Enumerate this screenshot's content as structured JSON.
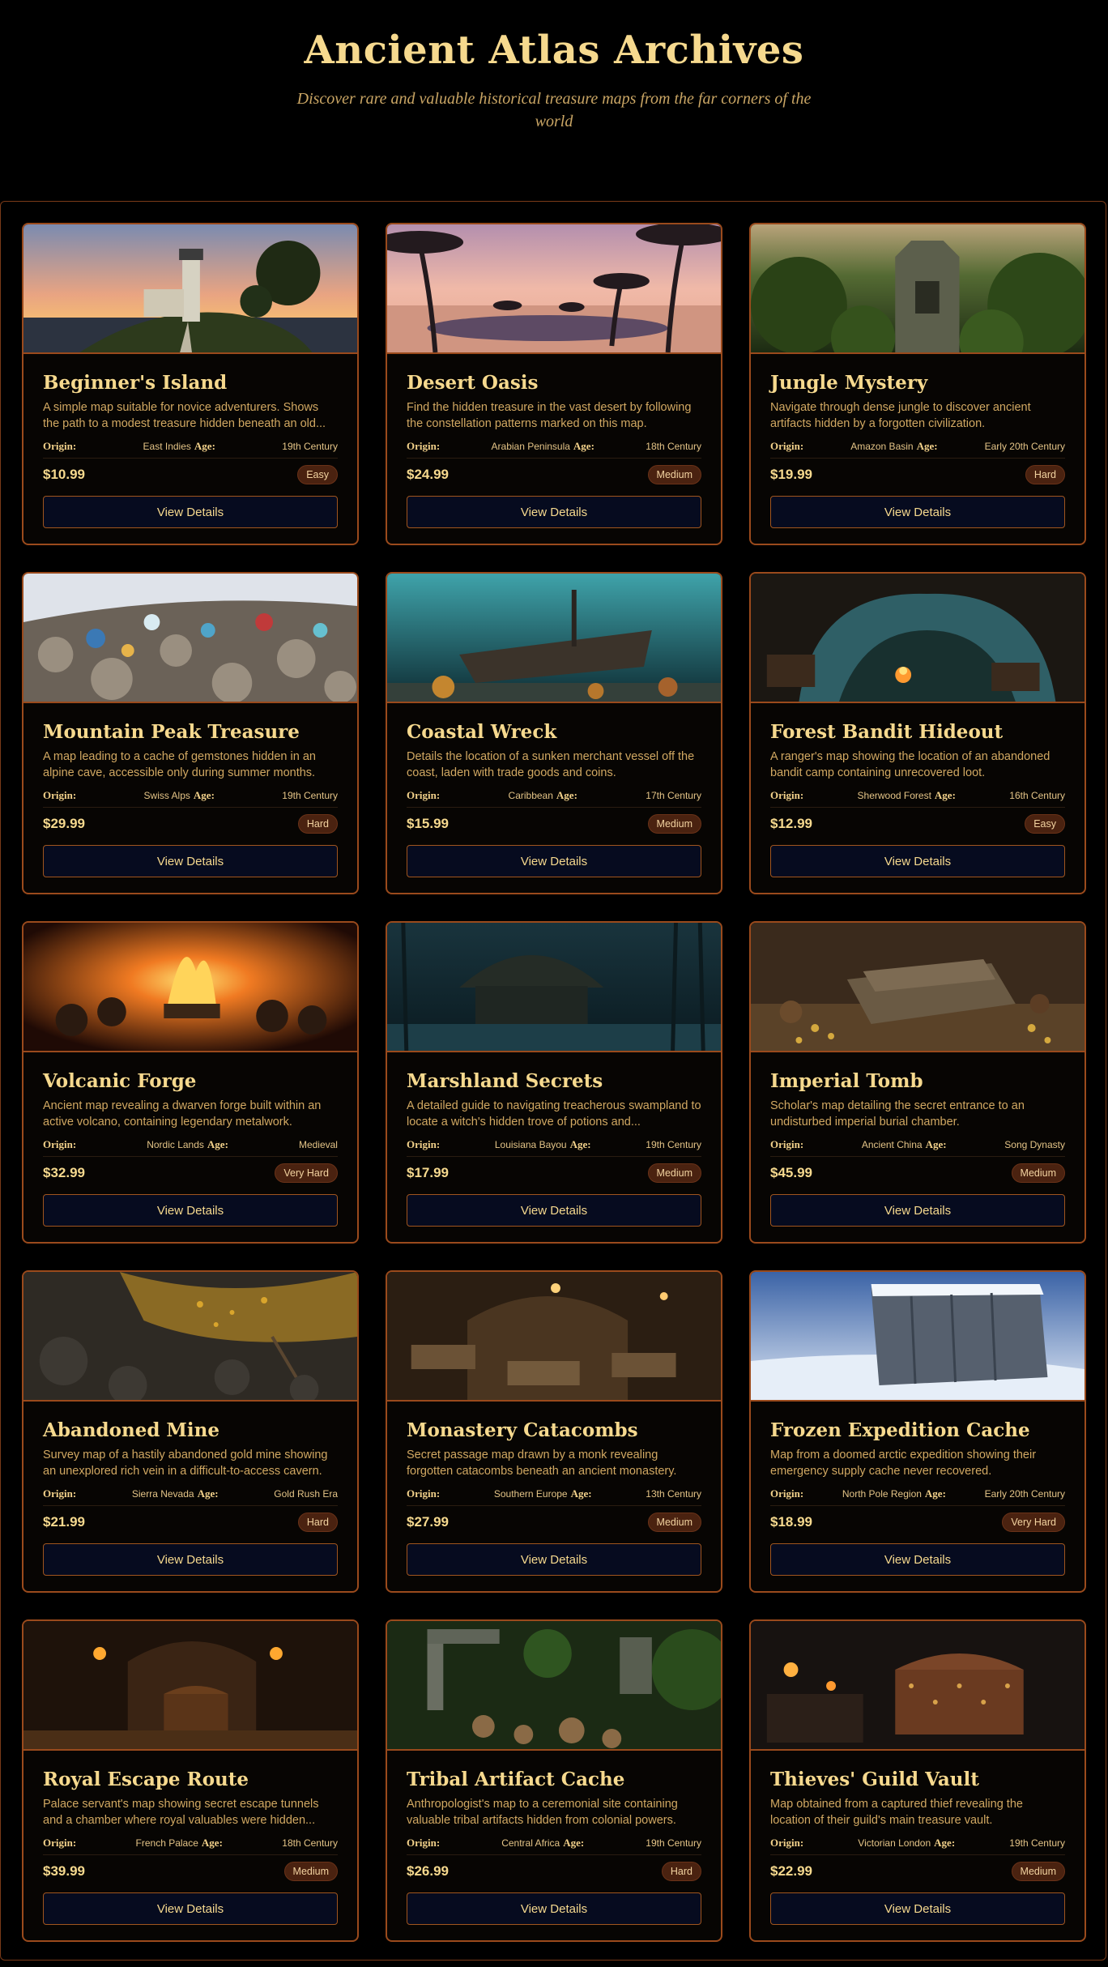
{
  "header": {
    "title": "Ancient Atlas Archives",
    "subtitle": "Discover rare and valuable historical treasure maps from the far corners of the world"
  },
  "labels": {
    "origin": "Origin:",
    "age": "Age:",
    "button": "View Details"
  },
  "colors": {
    "accent": "#f6d98e",
    "border": "#9a4a1c",
    "button_bg": "#060b1f",
    "badge_bg": "#4a2210"
  },
  "maps": [
    {
      "title": "Beginner's Island",
      "description": "A simple map suitable for novice adventurers. Shows the path to a modest treasure hidden beneath an old...",
      "origin": "East Indies",
      "age": "19th Century",
      "price": "$10.99",
      "difficulty": "Easy",
      "image": "lighthouse-island"
    },
    {
      "title": "Desert Oasis",
      "description": "Find the hidden treasure in the vast desert by following the constellation patterns marked on this map.",
      "origin": "Arabian Peninsula",
      "age": "18th Century",
      "price": "$24.99",
      "difficulty": "Medium",
      "image": "desert-oasis"
    },
    {
      "title": "Jungle Mystery",
      "description": "Navigate through dense jungle to discover ancient artifacts hidden by a forgotten civilization.",
      "origin": "Amazon Basin",
      "age": "Early 20th Century",
      "price": "$19.99",
      "difficulty": "Hard",
      "image": "jungle-temple"
    },
    {
      "title": "Mountain Peak Treasure",
      "description": "A map leading to a cache of gemstones hidden in an alpine cave, accessible only during summer months.",
      "origin": "Swiss Alps",
      "age": "19th Century",
      "price": "$29.99",
      "difficulty": "Hard",
      "image": "gem-rocks"
    },
    {
      "title": "Coastal Wreck",
      "description": "Details the location of a sunken merchant vessel off the coast, laden with trade goods and coins.",
      "origin": "Caribbean",
      "age": "17th Century",
      "price": "$15.99",
      "difficulty": "Medium",
      "image": "shipwreck"
    },
    {
      "title": "Forest Bandit Hideout",
      "description": "A ranger's map showing the location of an abandoned bandit camp containing unrecovered loot.",
      "origin": "Sherwood Forest",
      "age": "16th Century",
      "price": "$12.99",
      "difficulty": "Easy",
      "image": "forest-cave"
    },
    {
      "title": "Volcanic Forge",
      "description": "Ancient map revealing a dwarven forge built within an active volcano, containing legendary metalwork.",
      "origin": "Nordic Lands",
      "age": "Medieval",
      "price": "$32.99",
      "difficulty": "Very Hard",
      "image": "forge-fire"
    },
    {
      "title": "Marshland Secrets",
      "description": "A detailed guide to navigating treacherous swampland to locate a witch's hidden trove of potions and...",
      "origin": "Louisiana Bayou",
      "age": "19th Century",
      "price": "$17.99",
      "difficulty": "Medium",
      "image": "swamp-hut"
    },
    {
      "title": "Imperial Tomb",
      "description": "Scholar's map detailing the secret entrance to an undisturbed imperial burial chamber.",
      "origin": "Ancient China",
      "age": "Song Dynasty",
      "price": "$45.99",
      "difficulty": "Medium",
      "image": "tomb-gold"
    },
    {
      "title": "Abandoned Mine",
      "description": "Survey map of a hastily abandoned gold mine showing an unexplored rich vein in a difficult-to-access cavern.",
      "origin": "Sierra Nevada",
      "age": "Gold Rush Era",
      "price": "$21.99",
      "difficulty": "Hard",
      "image": "gold-mine"
    },
    {
      "title": "Monastery Catacombs",
      "description": "Secret passage map drawn by a monk revealing forgotten catacombs beneath an ancient monastery.",
      "origin": "Southern Europe",
      "age": "13th Century",
      "price": "$27.99",
      "difficulty": "Medium",
      "image": "catacombs"
    },
    {
      "title": "Frozen Expedition Cache",
      "description": "Map from a doomed arctic expedition showing their emergency supply cache never recovered.",
      "origin": "North Pole Region",
      "age": "Early 20th Century",
      "price": "$18.99",
      "difficulty": "Very Hard",
      "image": "frozen-crate"
    },
    {
      "title": "Royal Escape Route",
      "description": "Palace servant's map showing secret escape tunnels and a chamber where royal valuables were hidden...",
      "origin": "French Palace",
      "age": "18th Century",
      "price": "$39.99",
      "difficulty": "Medium",
      "image": "torch-chest"
    },
    {
      "title": "Tribal Artifact Cache",
      "description": "Anthropologist's map to a ceremonial site containing valuable tribal artifacts hidden from colonial powers.",
      "origin": "Central Africa",
      "age": "19th Century",
      "price": "$26.99",
      "difficulty": "Hard",
      "image": "jungle-ruins"
    },
    {
      "title": "Thieves' Guild Vault",
      "description": "Map obtained from a captured thief revealing the location of their guild's main treasure vault.",
      "origin": "Victorian London",
      "age": "19th Century",
      "price": "$22.99",
      "difficulty": "Medium",
      "image": "ornate-chest"
    }
  ]
}
